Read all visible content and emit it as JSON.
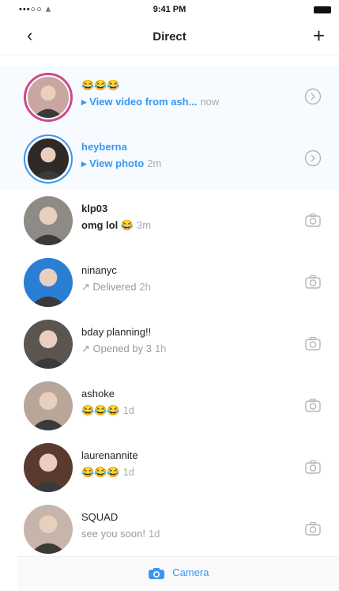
{
  "status_bar": {
    "signal": "•••○○ ⩓",
    "time": "9:41 PM"
  },
  "nav": {
    "back_icon": "‹",
    "title": "Direct",
    "new_icon": "+"
  },
  "threads": [
    {
      "name": "😂😂😂",
      "sub": "▸ View video from ash...",
      "time": "now",
      "action": "reply-icon",
      "unread": true,
      "avatar_bg": "#c9a6a0"
    },
    {
      "name": "heyberna",
      "sub": "▸ View photo",
      "time": "2m",
      "action": "reply-icon",
      "unread": true,
      "avatar_bg": "#2f2a28"
    },
    {
      "name": "klp03",
      "sub": "omg lol 😂",
      "time": "3m",
      "action": "camera-icon",
      "unread": true,
      "avatar_bg": "#8e8a86"
    },
    {
      "name": "ninanyc",
      "sub": "↗ Delivered",
      "time": "2h",
      "action": "camera-icon",
      "unread": false,
      "avatar_bg": "#2a7fd4"
    },
    {
      "name": "bday planning!!",
      "sub": "↗ Opened by 3",
      "time": "1h",
      "action": "camera-icon",
      "unread": false,
      "avatar_bg": "#5a5550"
    },
    {
      "name": "ashoke",
      "sub": "😂😂😂",
      "time": "1d",
      "action": "camera-icon",
      "unread": false,
      "avatar_bg": "#b8a69a"
    },
    {
      "name": "laurenannite",
      "sub": "😂😂😂",
      "time": "1d",
      "action": "camera-icon",
      "unread": false,
      "avatar_bg": "#5a3a2e"
    },
    {
      "name": "SQUAD",
      "sub": "see you soon!",
      "time": "1d",
      "action": "camera-icon",
      "unread": false,
      "avatar_bg": "#c7b4aa"
    }
  ],
  "bottom": {
    "camera_label": "Camera"
  },
  "colors": {
    "accent": "#3897f0",
    "text": "#262626",
    "muted": "#999999"
  }
}
